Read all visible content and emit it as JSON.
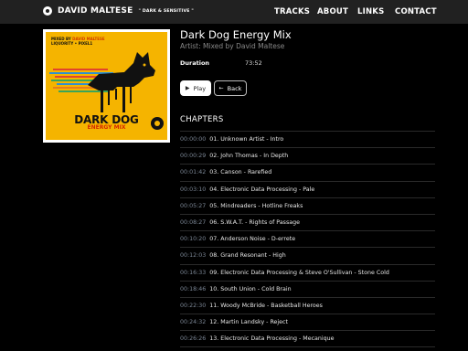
{
  "header": {
    "brand_name": "DAVID MALTESE",
    "brand_tagline": "\" DARK & SENSITIVE \"",
    "nav": [
      "TRACKS",
      "ABOUT",
      "LINKS",
      "CONTACT"
    ]
  },
  "cover": {
    "meta_line1_prefix": "MIXED BY",
    "meta_line1_name": "DAVID MALTESE",
    "meta_line2": "LIQUORITY • PIXEL1",
    "title": "DARK DOG",
    "subtitle": "ENERGY MIX",
    "accent_color": "#f5b400",
    "icon": "dog-silhouette"
  },
  "mix": {
    "title": "Dark Dog Energy Mix",
    "artist": "Artist: Mixed by David Maltese",
    "duration_label": "Duration",
    "duration_value": "73:52"
  },
  "buttons": {
    "play": "Play",
    "back": "Back"
  },
  "chapters_heading": "CHAPTERS",
  "chapters": [
    {
      "time": "00:00:00",
      "title": "01. Unknown Artist - Intro"
    },
    {
      "time": "00:00:29",
      "title": "02. John Thomas - In Depth"
    },
    {
      "time": "00:01:42",
      "title": "03. Canson - Rarefied"
    },
    {
      "time": "00:03:10",
      "title": "04. Electronic Data Processing - Pale"
    },
    {
      "time": "00:05:27",
      "title": "05. Mindreaders - Hotline Freaks"
    },
    {
      "time": "00:08:27",
      "title": "06. S.W.A.T. - Rights of Passage"
    },
    {
      "time": "00:10:20",
      "title": "07. Anderson Noise - D-errete"
    },
    {
      "time": "00:12:03",
      "title": "08. Grand Resonant - High"
    },
    {
      "time": "00:16:33",
      "title": "09. Electronic Data Processing & Steve O'Sullivan - Stone Cold"
    },
    {
      "time": "00:18:46",
      "title": "10. South Union - Cold Brain"
    },
    {
      "time": "00:22:30",
      "title": "11. Woody McBride - Basketball Heroes"
    },
    {
      "time": "00:24:32",
      "title": "12. Martin Landsky - Reject"
    },
    {
      "time": "00:26:26",
      "title": "13. Electronic Data Processing - Mecanique"
    }
  ]
}
